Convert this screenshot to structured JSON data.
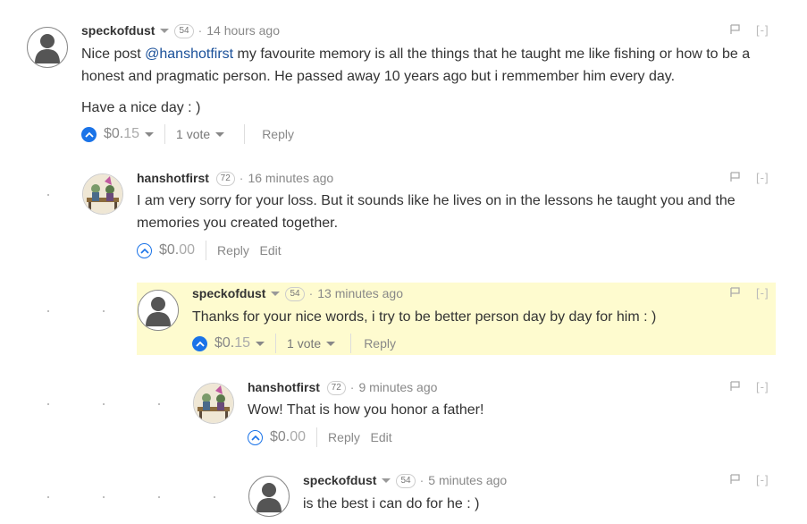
{
  "colors": {
    "accent": "#1a73e8",
    "highlight": "#fefbcf",
    "mention": "#1a5099"
  },
  "comments": [
    {
      "author": "speckofdust",
      "reputation": "54",
      "time": "14 hours ago",
      "body_pre": "Nice post ",
      "mention": "@hanshotfirst",
      "body_post": " my favourite memory is all the things that he taught me like fishing or how to be a honest and pragmatic person. He passed away 10 years ago but i remmember him every day.",
      "body_p2": "Have a nice day : )",
      "payout_int": "$0.",
      "payout_dec": "15",
      "votes": "1 vote",
      "reply": "Reply",
      "collapse": "[-]"
    },
    {
      "author": "hanshotfirst",
      "reputation": "72",
      "time": "16 minutes ago",
      "body": "I am very sorry for your loss. But it sounds like he lives on in the lessons he taught you and the memories you created together.",
      "payout_int": "$0.",
      "payout_dec": "00",
      "reply": "Reply",
      "edit": "Edit",
      "collapse": "[-]"
    },
    {
      "author": "speckofdust",
      "reputation": "54",
      "time": "13 minutes ago",
      "body": "Thanks for your nice words, i try to be better person day by day for him : )",
      "payout_int": "$0.",
      "payout_dec": "15",
      "votes": "1 vote",
      "reply": "Reply",
      "collapse": "[-]"
    },
    {
      "author": "hanshotfirst",
      "reputation": "72",
      "time": "9 minutes ago",
      "body": "Wow! That is how you honor a father!",
      "payout_int": "$0.",
      "payout_dec": "00",
      "reply": "Reply",
      "edit": "Edit",
      "collapse": "[-]"
    },
    {
      "author": "speckofdust",
      "reputation": "54",
      "time": "5 minutes ago",
      "body": "is the best i can do for he : )",
      "collapse": "[-]"
    }
  ],
  "icons": [
    "user-placeholder-icon",
    "hanshotfirst-avatar-icon",
    "flag-icon",
    "upvote-icon",
    "caret-down-icon"
  ]
}
